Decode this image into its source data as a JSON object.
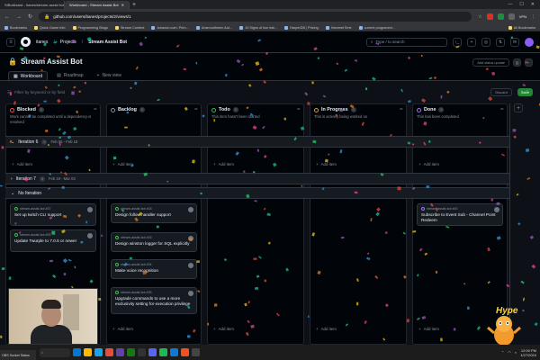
{
  "browser": {
    "tabs": [
      {
        "label": "StBotAssist - Itanes/stream-assist bot",
        "active": false
      },
      {
        "label": "Workboard - Stream Assist Bot",
        "active": true
      }
    ],
    "url": "github.com/users/itanes/projects/2/views/1",
    "vpn_label": "VPN",
    "bookmarks": [
      "Bookmarks",
      "Quick Game Info",
      "Programming Blogs",
      "Stream Content",
      "Amazon.com: Prim...",
      "Unsmoothmen Aut...",
      "10 Signs of low inte...",
      "HarperDB | Pricing",
      "HammerTime",
      "current programmi..."
    ],
    "all_bookmarks": "All Bookmarks"
  },
  "github": {
    "user": "itanes",
    "crumb_projects": "Projects",
    "crumb_project": "Stream Assist Bot",
    "search_placeholder": "Type / to search"
  },
  "project": {
    "title": "Stream Assist Bot",
    "add_status_update": "Add status update",
    "views": [
      {
        "label": "Workboard",
        "active": true
      },
      {
        "label": "Roadmap",
        "active": false
      },
      {
        "label": "New view",
        "active": false
      }
    ],
    "filter_placeholder": "Filter by keyword or by field",
    "discard": "Discard",
    "save": "Save"
  },
  "columns": [
    {
      "name": "Blocked",
      "count": "0",
      "desc": "Work cannot be completed until a dependency is resolved",
      "color": "#f85149"
    },
    {
      "name": "Backlog",
      "count": "0",
      "desc": "",
      "color": "#8b949e"
    },
    {
      "name": "Todo",
      "count": "0",
      "desc": "This item hasn't been started",
      "color": "#3fb950"
    },
    {
      "name": "In Progress",
      "count": "0",
      "desc": "This is actively being worked on",
      "color": "#d29922"
    },
    {
      "name": "Done",
      "count": "0",
      "desc": "This has been completed",
      "color": "#a371f7"
    }
  ],
  "groups": [
    {
      "name": "Iteration 6",
      "count": "0",
      "dates": "Feb 05 - Feb 18"
    },
    {
      "name": "Iteration 7",
      "count": "0",
      "dates": "Feb 19 - Mar 03"
    },
    {
      "name": "No Iteration",
      "count": "",
      "dates": ""
    }
  ],
  "add_item": "Add item",
  "cards": {
    "blocked": [
      {
        "ref": "stream-assist-bot #37",
        "title": "Set up twitch CLI support"
      },
      {
        "ref": "stream-assist-bot #93",
        "title": "Update Twurple to 7.0.6 or newer"
      }
    ],
    "backlog": [
      {
        "ref": "stream-assist-bot #18",
        "title": "Design follow handler support"
      },
      {
        "ref": "stream-assist-bot #16",
        "title": "Design winston logger for SQL explicitly"
      },
      {
        "ref": "stream-assist-bot #34",
        "title": "Make voice recognition"
      },
      {
        "ref": "stream-assist-bot #35",
        "title": "Upgrade commands to use a more exclusivity setting for execution privilege"
      }
    ],
    "done": [
      {
        "ref": "stream-assist-bot #40",
        "title": "Subscribe to Event Sub - Channel Point Redeem"
      }
    ]
  },
  "taskbar": {
    "status": "OBS Socket Status",
    "time": "12:00 PM",
    "date": "1/27/2024"
  },
  "overlay": {
    "hype": "Hype"
  }
}
